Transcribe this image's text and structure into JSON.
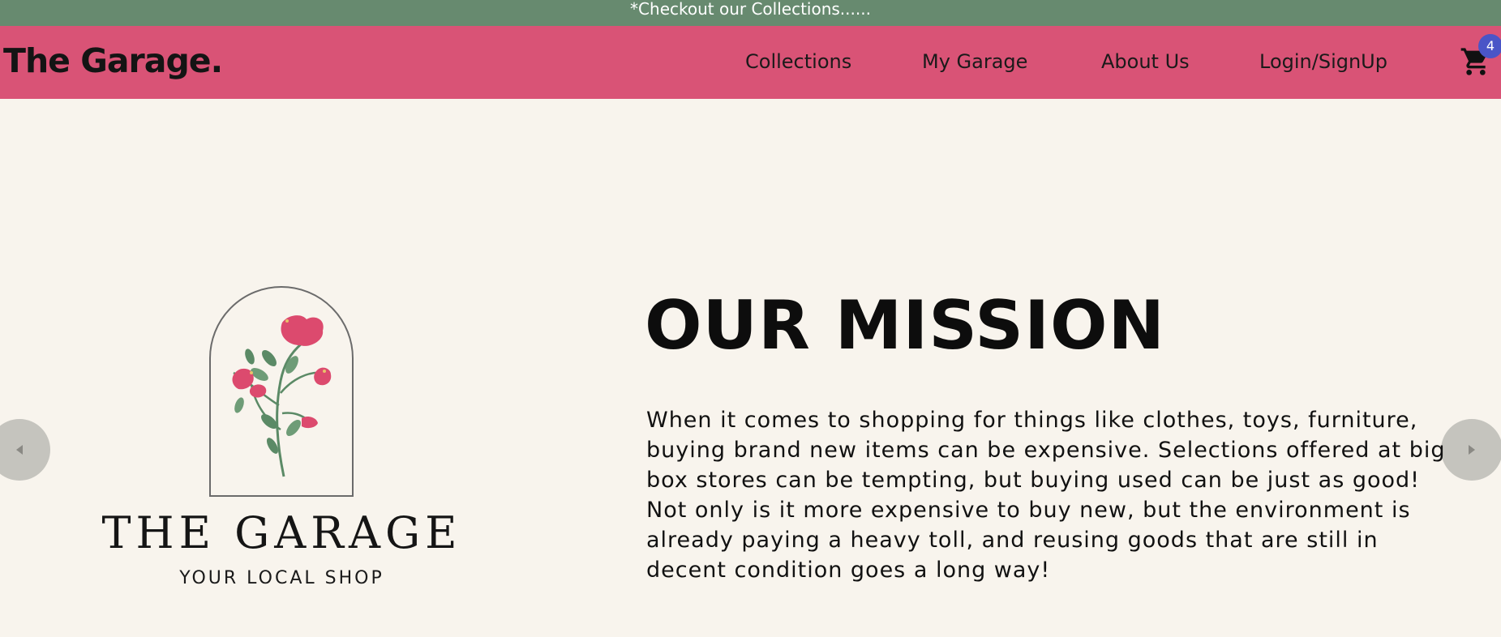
{
  "announcement": "*Checkout our Collections......",
  "brand": "The Garage.",
  "nav": {
    "items": [
      {
        "label": "Collections"
      },
      {
        "label": "My Garage"
      },
      {
        "label": "About Us"
      },
      {
        "label": "Login/SignUp"
      }
    ],
    "cart_count": "4",
    "cart_icon": "shopping-cart-icon"
  },
  "logo": {
    "title": "THE GARAGE",
    "subtitle": "YOUR LOCAL SHOP",
    "icon": "flower-arch-icon"
  },
  "mission": {
    "title": "OUR MISSION",
    "body": "When it comes to shopping for things like clothes, toys, furniture, buying brand new items can be expensive. Selections offered at big box stores can be tempting, but buying used can be just as good! Not only is it more expensive to buy new, but the environment is already paying a heavy toll, and reusing goods that are still in decent condition goes a long way!"
  },
  "carousel": {
    "prev_icon": "chevron-left-icon",
    "next_icon": "chevron-right-icon"
  },
  "colors": {
    "announcement_bg": "#678a6f",
    "navbar_bg": "#d95376",
    "page_bg": "#f8f4ed",
    "badge_bg": "#4a55c7",
    "arrow_bg": "#c5c4be"
  }
}
